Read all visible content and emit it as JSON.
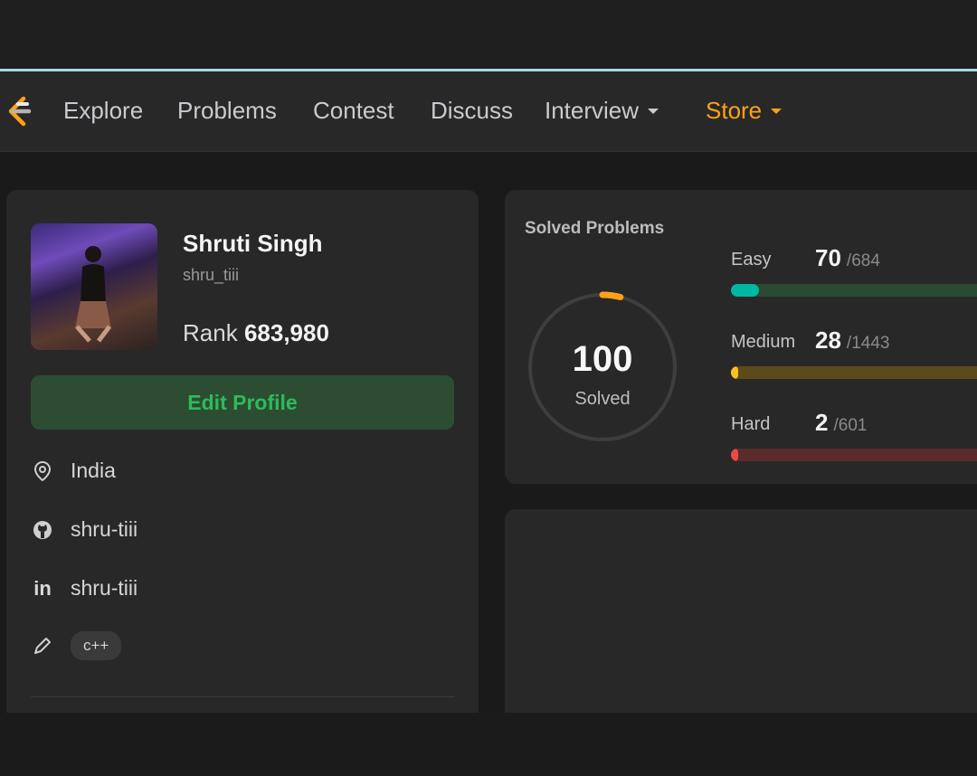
{
  "nav": {
    "items": [
      "Explore",
      "Problems",
      "Contest",
      "Discuss",
      "Interview",
      "Store"
    ],
    "accent_color": "#ffa116"
  },
  "profile": {
    "name": "Shruti Singh",
    "username": "shru_tiii",
    "rank_label": "Rank",
    "rank_value": "683,980",
    "edit_button": "Edit Profile",
    "location": "India",
    "github": "shru-tiii",
    "linkedin": "shru-tiii",
    "skill_tag": "c++"
  },
  "solved": {
    "title": "Solved Problems",
    "total": "100",
    "total_label": "Solved",
    "progress_fraction": 0.04,
    "easy": {
      "label": "Easy",
      "count": "70",
      "total": "/684",
      "fraction": 0.102,
      "color": "#00b8a3",
      "track": "#2a4a33"
    },
    "medium": {
      "label": "Medium",
      "count": "28",
      "total": "/1443",
      "fraction": 0.019,
      "color": "#ffc01e",
      "track": "#5b4a1b"
    },
    "hard": {
      "label": "Hard",
      "count": "2",
      "total": "/601",
      "fraction": 0.003,
      "color": "#ef4743",
      "track": "#5a2b28"
    }
  },
  "icons": [
    "leetcode-logo",
    "caret-down-icon",
    "location-pin-icon",
    "github-icon",
    "linkedin-icon",
    "pencil-icon"
  ]
}
